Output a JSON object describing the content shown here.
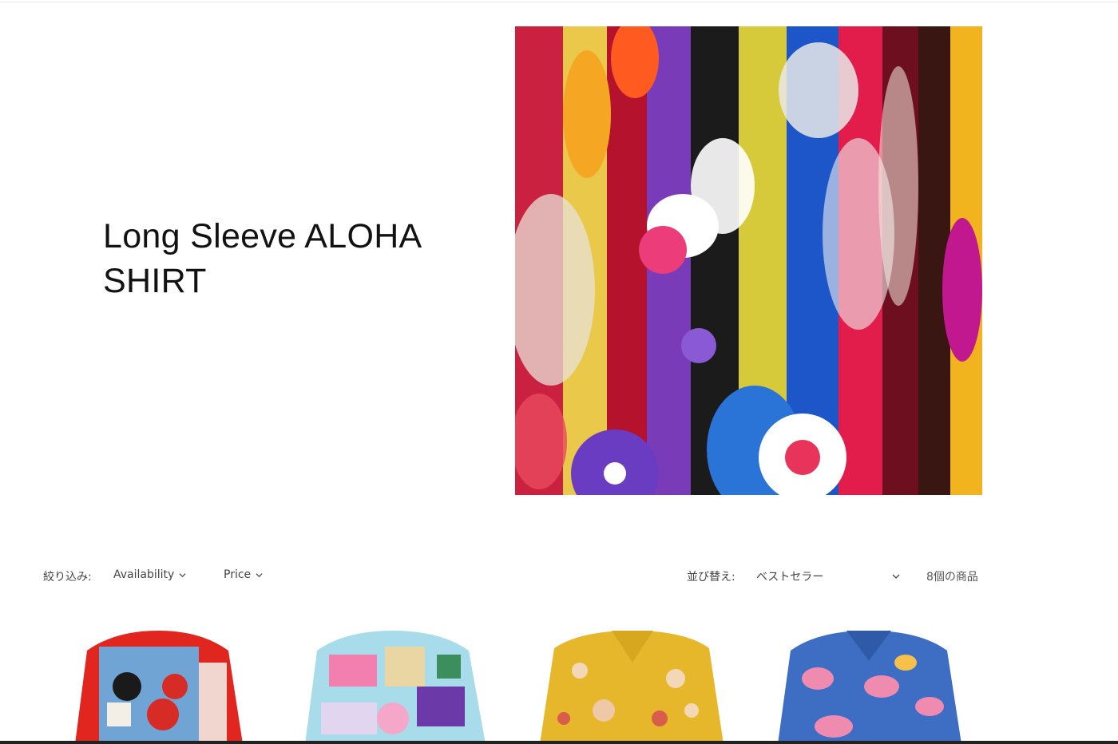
{
  "collection": {
    "title": "Long Sleeve ALOHA SHIRT"
  },
  "banner": {
    "image_icon": "aloha-shirts-rack-image"
  },
  "filters": {
    "label": "絞り込み:",
    "availability": "Availability",
    "price": "Price"
  },
  "sort": {
    "label": "並び替え:",
    "selected": "ベストセラー"
  },
  "product_count": "8個の商品",
  "products": [
    {
      "image": "red-shirt-illustrated-back"
    },
    {
      "image": "multicolor-pattern-shirt"
    },
    {
      "image": "yellow-print-shirt"
    },
    {
      "image": "blue-print-shirt"
    }
  ]
}
